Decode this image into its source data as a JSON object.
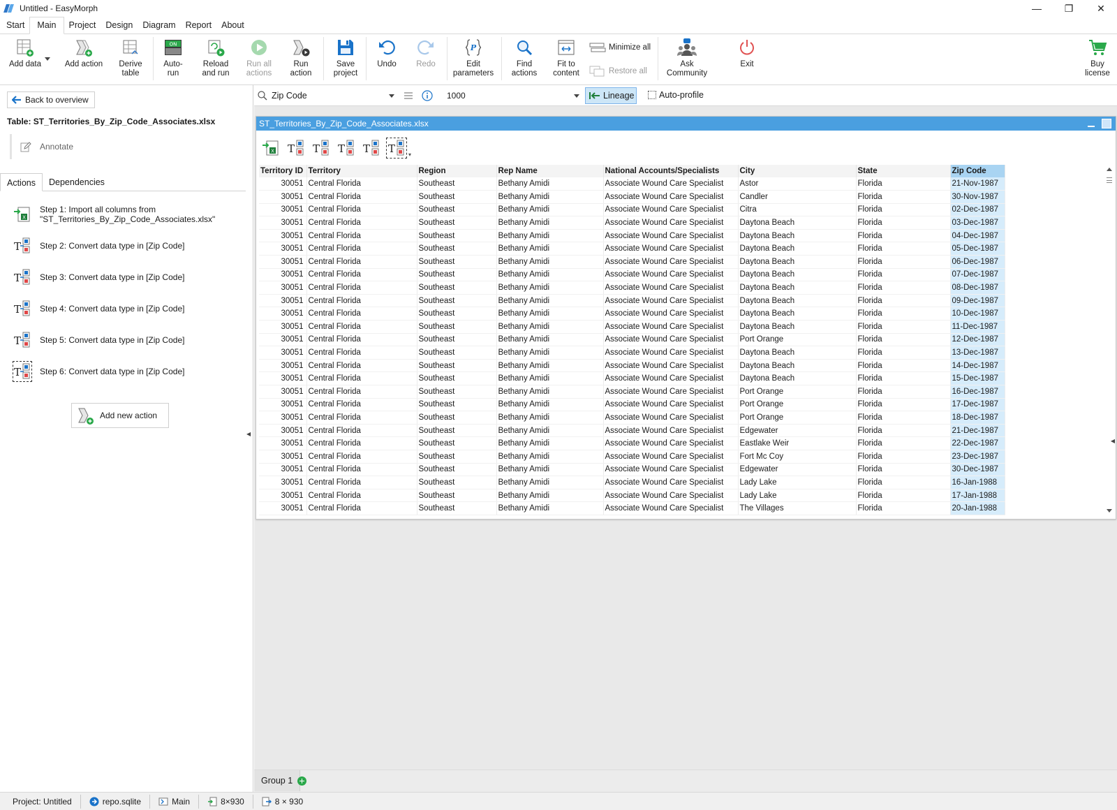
{
  "window": {
    "title": "Untitled - EasyMorph",
    "minimize": "—",
    "restore": "❐",
    "close": "✕"
  },
  "menu": [
    "Start",
    "Main",
    "Project",
    "Design",
    "Diagram",
    "Report",
    "About"
  ],
  "ribbon": {
    "add_data": "Add data",
    "add_action": "Add action",
    "derive_table_1": "Derive",
    "derive_table_2": "table",
    "auto_run_1": "Auto-",
    "auto_run_2": "run",
    "auto_on": "ON",
    "reload_1": "Reload",
    "reload_2": "and run",
    "run_all_1": "Run all",
    "run_all_2": "actions",
    "run_action_1": "Run",
    "run_action_2": "action",
    "save_1": "Save",
    "save_2": "project",
    "undo": "Undo",
    "redo": "Redo",
    "edit_params_1": "Edit",
    "edit_params_2": "parameters",
    "find_actions_1": "Find",
    "find_actions_2": "actions",
    "fit_1": "Fit to",
    "fit_2": "content",
    "minimize_all": "Minimize all",
    "restore_all": "Restore all",
    "ask_1": "Ask",
    "ask_2": "Community",
    "exit": "Exit",
    "buy_1": "Buy",
    "buy_2": "license"
  },
  "left": {
    "back": "Back to overview",
    "table_title": "Table: ST_Territories_By_Zip_Code_Associates.xlsx",
    "annotate": "Annotate",
    "tabs": [
      "Actions",
      "Dependencies"
    ],
    "steps": [
      {
        "line1": "Step 1: Import all columns from",
        "line2": "\"ST_Territories_By_Zip_Code_Associates.xlsx\""
      },
      {
        "line1": "Step 2: Convert data type in [Zip Code]"
      },
      {
        "line1": "Step 3: Convert data type in [Zip Code]"
      },
      {
        "line1": "Step 4: Convert data type in [Zip Code]"
      },
      {
        "line1": "Step 5: Convert data type in [Zip Code]"
      },
      {
        "line1": "Step 6: Convert data type in [Zip Code]"
      }
    ],
    "add_new_action": "Add new action"
  },
  "filterbar": {
    "column": "Zip Code",
    "rows": "1000",
    "lineage": "Lineage",
    "auto_profile": "Auto-profile"
  },
  "table_window": {
    "title": "ST_Territories_By_Zip_Code_Associates.xlsx",
    "columns": [
      "Territory ID",
      "Territory",
      "Region",
      "Rep Name",
      "National Accounts/Specialists",
      "City",
      "State",
      "Zip Code"
    ],
    "rows": [
      [
        "30051",
        "Central Florida",
        "Southeast",
        "Bethany Amidi",
        "Associate Wound Care Specialist",
        "Astor",
        "Florida",
        "21-Nov-1987"
      ],
      [
        "30051",
        "Central Florida",
        "Southeast",
        "Bethany Amidi",
        "Associate Wound Care Specialist",
        "Candler",
        "Florida",
        "30-Nov-1987"
      ],
      [
        "30051",
        "Central Florida",
        "Southeast",
        "Bethany Amidi",
        "Associate Wound Care Specialist",
        "Citra",
        "Florida",
        "02-Dec-1987"
      ],
      [
        "30051",
        "Central Florida",
        "Southeast",
        "Bethany Amidi",
        "Associate Wound Care Specialist",
        "Daytona Beach",
        "Florida",
        "03-Dec-1987"
      ],
      [
        "30051",
        "Central Florida",
        "Southeast",
        "Bethany Amidi",
        "Associate Wound Care Specialist",
        "Daytona Beach",
        "Florida",
        "04-Dec-1987"
      ],
      [
        "30051",
        "Central Florida",
        "Southeast",
        "Bethany Amidi",
        "Associate Wound Care Specialist",
        "Daytona Beach",
        "Florida",
        "05-Dec-1987"
      ],
      [
        "30051",
        "Central Florida",
        "Southeast",
        "Bethany Amidi",
        "Associate Wound Care Specialist",
        "Daytona Beach",
        "Florida",
        "06-Dec-1987"
      ],
      [
        "30051",
        "Central Florida",
        "Southeast",
        "Bethany Amidi",
        "Associate Wound Care Specialist",
        "Daytona Beach",
        "Florida",
        "07-Dec-1987"
      ],
      [
        "30051",
        "Central Florida",
        "Southeast",
        "Bethany Amidi",
        "Associate Wound Care Specialist",
        "Daytona Beach",
        "Florida",
        "08-Dec-1987"
      ],
      [
        "30051",
        "Central Florida",
        "Southeast",
        "Bethany Amidi",
        "Associate Wound Care Specialist",
        "Daytona Beach",
        "Florida",
        "09-Dec-1987"
      ],
      [
        "30051",
        "Central Florida",
        "Southeast",
        "Bethany Amidi",
        "Associate Wound Care Specialist",
        "Daytona Beach",
        "Florida",
        "10-Dec-1987"
      ],
      [
        "30051",
        "Central Florida",
        "Southeast",
        "Bethany Amidi",
        "Associate Wound Care Specialist",
        "Daytona Beach",
        "Florida",
        "11-Dec-1987"
      ],
      [
        "30051",
        "Central Florida",
        "Southeast",
        "Bethany Amidi",
        "Associate Wound Care Specialist",
        "Port Orange",
        "Florida",
        "12-Dec-1987"
      ],
      [
        "30051",
        "Central Florida",
        "Southeast",
        "Bethany Amidi",
        "Associate Wound Care Specialist",
        "Daytona Beach",
        "Florida",
        "13-Dec-1987"
      ],
      [
        "30051",
        "Central Florida",
        "Southeast",
        "Bethany Amidi",
        "Associate Wound Care Specialist",
        "Daytona Beach",
        "Florida",
        "14-Dec-1987"
      ],
      [
        "30051",
        "Central Florida",
        "Southeast",
        "Bethany Amidi",
        "Associate Wound Care Specialist",
        "Daytona Beach",
        "Florida",
        "15-Dec-1987"
      ],
      [
        "30051",
        "Central Florida",
        "Southeast",
        "Bethany Amidi",
        "Associate Wound Care Specialist",
        "Port Orange",
        "Florida",
        "16-Dec-1987"
      ],
      [
        "30051",
        "Central Florida",
        "Southeast",
        "Bethany Amidi",
        "Associate Wound Care Specialist",
        "Port Orange",
        "Florida",
        "17-Dec-1987"
      ],
      [
        "30051",
        "Central Florida",
        "Southeast",
        "Bethany Amidi",
        "Associate Wound Care Specialist",
        "Port Orange",
        "Florida",
        "18-Dec-1987"
      ],
      [
        "30051",
        "Central Florida",
        "Southeast",
        "Bethany Amidi",
        "Associate Wound Care Specialist",
        "Edgewater",
        "Florida",
        "21-Dec-1987"
      ],
      [
        "30051",
        "Central Florida",
        "Southeast",
        "Bethany Amidi",
        "Associate Wound Care Specialist",
        "Eastlake Weir",
        "Florida",
        "22-Dec-1987"
      ],
      [
        "30051",
        "Central Florida",
        "Southeast",
        "Bethany Amidi",
        "Associate Wound Care Specialist",
        "Fort Mc Coy",
        "Florida",
        "23-Dec-1987"
      ],
      [
        "30051",
        "Central Florida",
        "Southeast",
        "Bethany Amidi",
        "Associate Wound Care Specialist",
        "Edgewater",
        "Florida",
        "30-Dec-1987"
      ],
      [
        "30051",
        "Central Florida",
        "Southeast",
        "Bethany Amidi",
        "Associate Wound Care Specialist",
        "Lady Lake",
        "Florida",
        "16-Jan-1988"
      ],
      [
        "30051",
        "Central Florida",
        "Southeast",
        "Bethany Amidi",
        "Associate Wound Care Specialist",
        "Lady Lake",
        "Florida",
        "17-Jan-1988"
      ],
      [
        "30051",
        "Central Florida",
        "Southeast",
        "Bethany Amidi",
        "Associate Wound Care Specialist",
        "The Villages",
        "Florida",
        "20-Jan-1988"
      ]
    ]
  },
  "groups": {
    "active": "Group 1"
  },
  "status": {
    "project": "Project: Untitled",
    "repo": "repo.sqlite",
    "module": "Main",
    "dims1": "8×930",
    "dims2": "8 × 930"
  },
  "colors": {
    "accent": "#4a9fe0",
    "selected_column": "#d6ecfb",
    "lineage_bg": "#cde6f7",
    "green": "#2aa84a"
  }
}
